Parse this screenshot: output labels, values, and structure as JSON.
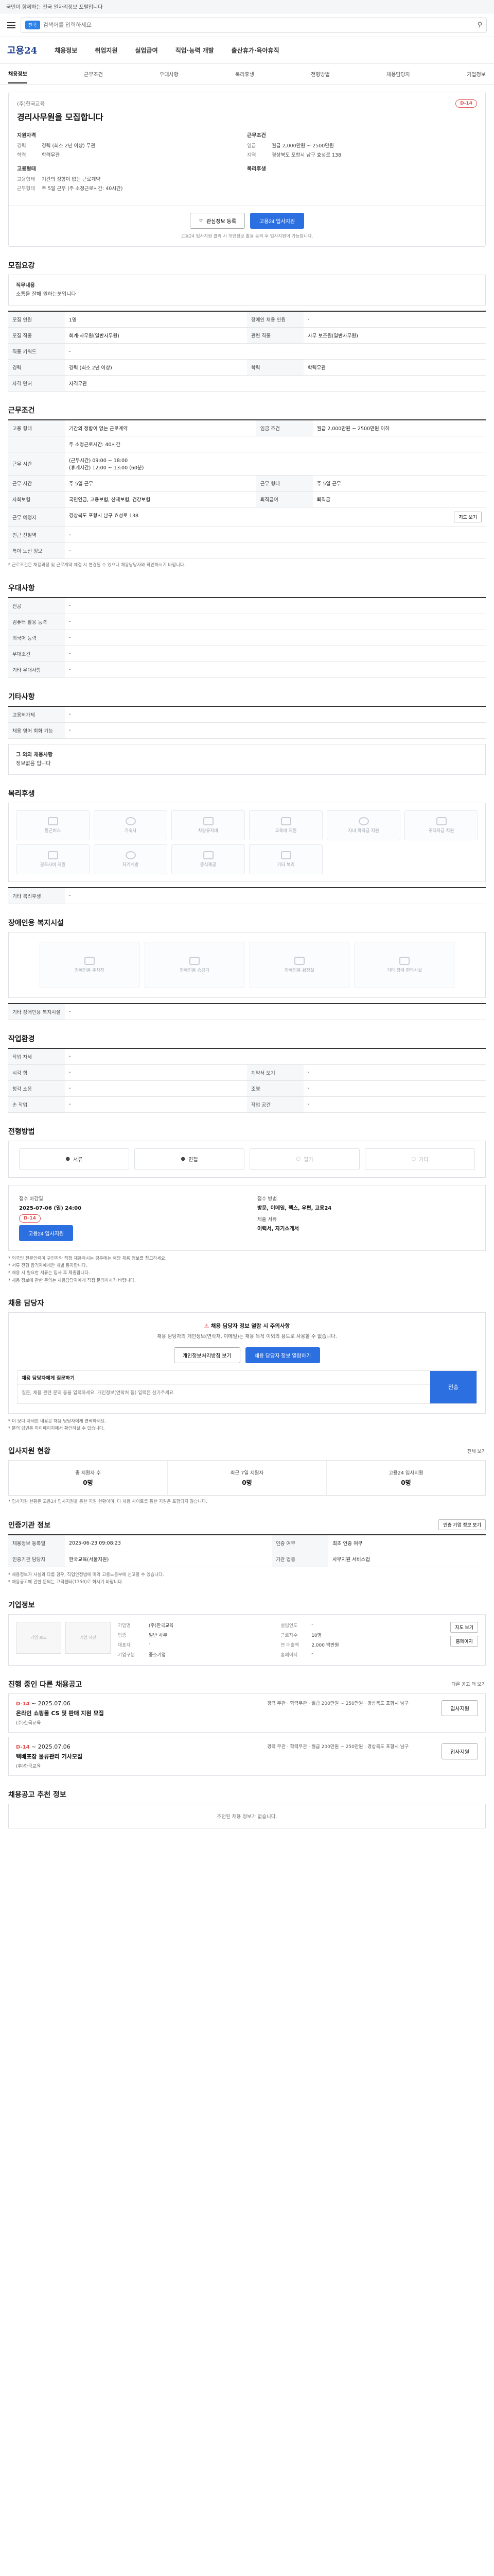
{
  "topbar": {
    "notice": "국민이 함께하는 전국 일자리정보 포털입니다"
  },
  "search": {
    "tag": "전국",
    "placeholder": "검색어를 입력하세요"
  },
  "header": {
    "logo": "고용24",
    "nav": [
      "채용정보",
      "취업지원",
      "실업급여",
      "직업·능력 개발",
      "출산휴가·육아휴직"
    ]
  },
  "tabs": [
    "채용정보",
    "근무조건",
    "우대사항",
    "복리후생",
    "전형방법",
    "채용담당자",
    "기업정보"
  ],
  "job": {
    "company": "(주)한국교육",
    "title": "경리사무원을 모집합니다",
    "dday": "D-14",
    "summary_left": [
      {
        "head": "지원자격",
        "rows": [
          [
            "경력",
            "경력 (최소 2년 이상) 무관"
          ],
          [
            "학력",
            "학력무관"
          ]
        ]
      },
      {
        "head": "고용형태",
        "rows": [
          [
            "고용형태",
            "기간의 정함이 없는 근로계약"
          ],
          [
            "근무형태",
            "주 5일 근무 (주 소정근로시간: 40시간)"
          ]
        ]
      }
    ],
    "summary_right": [
      {
        "head": "근무조건",
        "rows": [
          [
            "임금",
            "월급 2,000만원 ~ 2500만원"
          ],
          [
            "지역",
            "경상북도 포항시 남구 효성로 138"
          ]
        ]
      },
      {
        "head": "복리후생",
        "rows": []
      }
    ]
  },
  "actions": {
    "bookmark": "관심정보 등록",
    "apply": "고용24 입사지원",
    "note": "고용24 입사지원 클릭 시 개인정보 활용 동의 후 입사지원이 가능합니다."
  },
  "s_recruit": {
    "title": "모집요강",
    "label": "직무내용",
    "text": "소통을 잘해 원하는분입니다"
  },
  "recruit_table": [
    [
      "모집 인원",
      "1명",
      "장애인 채용 인원",
      "-"
    ],
    [
      "모집 직종",
      "회계·사무원(일반사무원)",
      "관련 직종",
      "사무 보조원(일반사무원)"
    ],
    [
      "직종 키워드",
      "-",
      "",
      ""
    ],
    [
      "경력",
      "경력 (최소 2년 이상)",
      "학력",
      "학력무관"
    ],
    [
      "자격 면허",
      "자격무관",
      "",
      ""
    ]
  ],
  "s_cond": {
    "title": "근무조건"
  },
  "cond_table": [
    [
      "고용 형태",
      "기간의 정함이 없는 근로계약",
      "임금 조건",
      "월급 2,000만원 ~ 2500만원 이하"
    ],
    [
      "",
      "주 소정근로시간: 40시간",
      "",
      ""
    ],
    [
      "근무 시간",
      "(근무시간) 09:00 ~ 18:00\n(휴게시간) 12:00 ~ 13:00 (60분)",
      "",
      ""
    ],
    [
      "근무 시간",
      "주 5일 근무",
      "근무 형태",
      "주 5일 근무"
    ],
    [
      "사회보험",
      "국민연금, 고용보험, 산재보험, 건강보험",
      "퇴직급여",
      "퇴직금"
    ],
    [
      "근무 예정지",
      "경상북도 포항시 남구 효성로 138",
      "",
      ""
    ],
    [
      "인근 전철역",
      "-",
      "",
      ""
    ],
    [
      "특이 노선 정보",
      "-",
      "",
      ""
    ]
  ],
  "map_btn": "지도 보기",
  "cond_note": "* 근로조건은 채용과정 및 근로계약 체결 시 변경될 수 있으니 채용담당자와 확인하시기 바랍니다.",
  "s_pref": {
    "title": "우대사항"
  },
  "pref_table": [
    [
      "전공",
      "-"
    ],
    [
      "컴퓨터 활용 능력",
      "-"
    ],
    [
      "외국어 능력",
      "-"
    ],
    [
      "우대조건",
      "-"
    ],
    [
      "기타 우대사항",
      "-"
    ]
  ],
  "s_etc": {
    "title": "기타사항"
  },
  "etc_table": [
    [
      "고용허가제",
      "-"
    ],
    [
      "채용 영어 회화 가능",
      "-"
    ]
  ],
  "etc_text": {
    "label": "그 외의 채용사항",
    "text": "정보없음 입니다"
  },
  "s_welf": {
    "title": "복리후생",
    "items": [
      "통근버스",
      "기숙사",
      "차량유지비",
      "교육비 지원",
      "자녀 학자금 지원",
      "주택자금 지원",
      "경조사비 지원",
      "자기계발",
      "중식제공",
      "기타 복리"
    ]
  },
  "welf_etc": {
    "label": "기타 복리후생",
    "value": "-"
  },
  "s_dis": {
    "title": "장애인용 복지시설",
    "items": [
      "장애인용 주차장",
      "장애인용 승강기",
      "장애인용 화장실",
      "기타 장애 편의시설"
    ]
  },
  "dis_etc": {
    "label": "기타 장애인용 복지시설",
    "value": "-"
  },
  "s_env": {
    "title": "작업환경"
  },
  "env_table": [
    [
      "작업 자세",
      "-",
      "",
      ""
    ],
    [
      "시각 힘",
      "-",
      "계약서 보기",
      "-"
    ],
    [
      "청각 소음",
      "-",
      "조명",
      "-"
    ],
    [
      "손 작업",
      "-",
      "작업 공간",
      "-"
    ]
  ],
  "s_proc": {
    "title": "전형방법",
    "items": [
      "서류",
      "면접",
      "필기",
      "기타"
    ]
  },
  "apply_info": {
    "deadline_k": "접수 마감일",
    "deadline": "2025-07-06 (일) 24:00",
    "dday": "D-14",
    "btn": "고용24 입사지원",
    "method_k": "접수 방법",
    "method": "방문, 이메일, 팩스, 우편, 고용24",
    "docs_k": "제출 서류",
    "docs": "이력서, 자기소개서"
  },
  "apply_notes": [
    "* 외국인 전문인력이 구인자와 직접 채용하시는 경우에는 해당 채용 정보를 참고하세요.",
    "* 서류 전형 합격자에게만 개별 통지합니다.",
    "* 채용 시 필요한 서류는 입사 후 제출합니다.",
    "* 채용 정보에 관한 문의는 채용담당자에게 직접 문의하시기 바랍니다."
  ],
  "s_contact": {
    "title": "채용 담당자",
    "warn_pre": "채용 담당자 정보 열람 시 주의사항",
    "warn_text": "채용 담당자의 개인정보(연락처, 이메일)는 채용 목적 이외의 용도로 사용할 수 없습니다.",
    "btn1": "개인정보처리방침 보기",
    "btn2": "채용 담당자 정보 열람하기",
    "inq_label": "채용 담당자에게 질문하기",
    "inq_placeholder": "질문, 채용 관련 문의 등을 입력하세요. 개인정보(연락처 등) 입력은 삼가주세요.",
    "inq_btn": "전송",
    "notes": [
      "* 더 보다 자세한 내용은 채용 담당자에게 연락하세요.",
      "* 문의 답변은 마이페이지에서 확인하실 수 있습니다."
    ]
  },
  "s_status": {
    "title": "입사지원 현황",
    "more": "전체 보기",
    "cols": [
      [
        "총 지원자 수",
        "0명"
      ],
      [
        "최근 7일 지원자",
        "0명"
      ],
      [
        "고용24 입사지원",
        "0명"
      ]
    ],
    "note": "* 입사지원 현황은 고용24 입사지원을 통한 지원 현황이며, 타 채용 사이트를 통한 지원은 포함되지 않습니다."
  },
  "s_org": {
    "title": "인증기관 정보",
    "btn": "인증 기업 정보 보기",
    "table": [
      [
        "채용정보 등록일",
        "2025-06-23 09:08:23",
        "인증 여부",
        "최초 인증 여부"
      ],
      [
        "인증기관 담당자",
        "한국교육(서울지원)",
        "기관 업종",
        "사무지원 서비스업"
      ]
    ],
    "notes": [
      "* 채용정보가 사실과 다를 경우, 직업안정법에 따라 고용노동부에 신고할 수 있습니다.",
      "* 채용공고에 관한 문의는 고객센터(1350)로 하시기 바랍니다."
    ]
  },
  "s_comp": {
    "title": "기업정보",
    "name": "(주)한국교육",
    "btn_map": "지도 보기",
    "btn_home": "홈페이지",
    "info": [
      [
        "기업명",
        "(주)한국교육",
        "설립연도",
        "-"
      ],
      [
        "업종",
        "일반 사무",
        "근로자수",
        "10명"
      ],
      [
        "대표자",
        "-",
        "연 매출액",
        "2,000 백만원"
      ],
      [
        "기업구분",
        "중소기업",
        "홈페이지",
        "-"
      ]
    ],
    "logo1": "기업 로고",
    "logo2": "기업 사진"
  },
  "s_other": {
    "title": "진행 중인 다른 채용공고",
    "more": "다른 공고 더 보기",
    "items": [
      {
        "dday": "D-14",
        "period": "~ 2025.07.06",
        "title": "온라인 쇼핑몰 CS 및 판매 지원 모집",
        "company": "(주)한국교육",
        "info": "경력 무관 · 학력무관 · 월급 200만원 ~ 250만원 · 경상북도 포항시 남구",
        "btn": "입사지원"
      },
      {
        "dday": "D-14",
        "period": "~ 2025.07.06",
        "title": "택배포장 물류관리 기사모집",
        "company": "(주)한국교육",
        "info": "경력 무관 · 학력무관 · 월급 200만원 ~ 250만원 · 경상북도 포항시 남구",
        "btn": "입사지원"
      }
    ]
  },
  "s_reco": {
    "title": "채용공고 추천 정보",
    "text": "추천된 채용 정보가 없습니다."
  }
}
